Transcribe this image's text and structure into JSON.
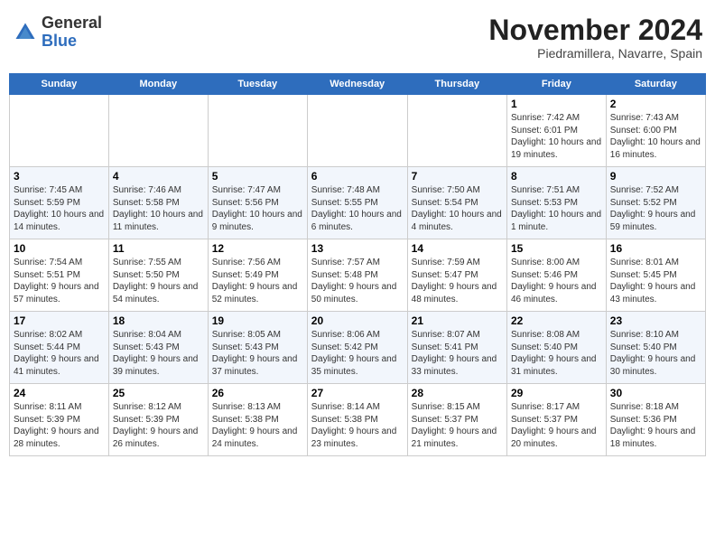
{
  "header": {
    "logo_line1": "General",
    "logo_line2": "Blue",
    "month": "November 2024",
    "location": "Piedramillera, Navarre, Spain"
  },
  "days_of_week": [
    "Sunday",
    "Monday",
    "Tuesday",
    "Wednesday",
    "Thursday",
    "Friday",
    "Saturday"
  ],
  "weeks": [
    [
      {
        "num": "",
        "info": ""
      },
      {
        "num": "",
        "info": ""
      },
      {
        "num": "",
        "info": ""
      },
      {
        "num": "",
        "info": ""
      },
      {
        "num": "",
        "info": ""
      },
      {
        "num": "1",
        "info": "Sunrise: 7:42 AM\nSunset: 6:01 PM\nDaylight: 10 hours and 19 minutes."
      },
      {
        "num": "2",
        "info": "Sunrise: 7:43 AM\nSunset: 6:00 PM\nDaylight: 10 hours and 16 minutes."
      }
    ],
    [
      {
        "num": "3",
        "info": "Sunrise: 7:45 AM\nSunset: 5:59 PM\nDaylight: 10 hours and 14 minutes."
      },
      {
        "num": "4",
        "info": "Sunrise: 7:46 AM\nSunset: 5:58 PM\nDaylight: 10 hours and 11 minutes."
      },
      {
        "num": "5",
        "info": "Sunrise: 7:47 AM\nSunset: 5:56 PM\nDaylight: 10 hours and 9 minutes."
      },
      {
        "num": "6",
        "info": "Sunrise: 7:48 AM\nSunset: 5:55 PM\nDaylight: 10 hours and 6 minutes."
      },
      {
        "num": "7",
        "info": "Sunrise: 7:50 AM\nSunset: 5:54 PM\nDaylight: 10 hours and 4 minutes."
      },
      {
        "num": "8",
        "info": "Sunrise: 7:51 AM\nSunset: 5:53 PM\nDaylight: 10 hours and 1 minute."
      },
      {
        "num": "9",
        "info": "Sunrise: 7:52 AM\nSunset: 5:52 PM\nDaylight: 9 hours and 59 minutes."
      }
    ],
    [
      {
        "num": "10",
        "info": "Sunrise: 7:54 AM\nSunset: 5:51 PM\nDaylight: 9 hours and 57 minutes."
      },
      {
        "num": "11",
        "info": "Sunrise: 7:55 AM\nSunset: 5:50 PM\nDaylight: 9 hours and 54 minutes."
      },
      {
        "num": "12",
        "info": "Sunrise: 7:56 AM\nSunset: 5:49 PM\nDaylight: 9 hours and 52 minutes."
      },
      {
        "num": "13",
        "info": "Sunrise: 7:57 AM\nSunset: 5:48 PM\nDaylight: 9 hours and 50 minutes."
      },
      {
        "num": "14",
        "info": "Sunrise: 7:59 AM\nSunset: 5:47 PM\nDaylight: 9 hours and 48 minutes."
      },
      {
        "num": "15",
        "info": "Sunrise: 8:00 AM\nSunset: 5:46 PM\nDaylight: 9 hours and 46 minutes."
      },
      {
        "num": "16",
        "info": "Sunrise: 8:01 AM\nSunset: 5:45 PM\nDaylight: 9 hours and 43 minutes."
      }
    ],
    [
      {
        "num": "17",
        "info": "Sunrise: 8:02 AM\nSunset: 5:44 PM\nDaylight: 9 hours and 41 minutes."
      },
      {
        "num": "18",
        "info": "Sunrise: 8:04 AM\nSunset: 5:43 PM\nDaylight: 9 hours and 39 minutes."
      },
      {
        "num": "19",
        "info": "Sunrise: 8:05 AM\nSunset: 5:43 PM\nDaylight: 9 hours and 37 minutes."
      },
      {
        "num": "20",
        "info": "Sunrise: 8:06 AM\nSunset: 5:42 PM\nDaylight: 9 hours and 35 minutes."
      },
      {
        "num": "21",
        "info": "Sunrise: 8:07 AM\nSunset: 5:41 PM\nDaylight: 9 hours and 33 minutes."
      },
      {
        "num": "22",
        "info": "Sunrise: 8:08 AM\nSunset: 5:40 PM\nDaylight: 9 hours and 31 minutes."
      },
      {
        "num": "23",
        "info": "Sunrise: 8:10 AM\nSunset: 5:40 PM\nDaylight: 9 hours and 30 minutes."
      }
    ],
    [
      {
        "num": "24",
        "info": "Sunrise: 8:11 AM\nSunset: 5:39 PM\nDaylight: 9 hours and 28 minutes."
      },
      {
        "num": "25",
        "info": "Sunrise: 8:12 AM\nSunset: 5:39 PM\nDaylight: 9 hours and 26 minutes."
      },
      {
        "num": "26",
        "info": "Sunrise: 8:13 AM\nSunset: 5:38 PM\nDaylight: 9 hours and 24 minutes."
      },
      {
        "num": "27",
        "info": "Sunrise: 8:14 AM\nSunset: 5:38 PM\nDaylight: 9 hours and 23 minutes."
      },
      {
        "num": "28",
        "info": "Sunrise: 8:15 AM\nSunset: 5:37 PM\nDaylight: 9 hours and 21 minutes."
      },
      {
        "num": "29",
        "info": "Sunrise: 8:17 AM\nSunset: 5:37 PM\nDaylight: 9 hours and 20 minutes."
      },
      {
        "num": "30",
        "info": "Sunrise: 8:18 AM\nSunset: 5:36 PM\nDaylight: 9 hours and 18 minutes."
      }
    ]
  ]
}
